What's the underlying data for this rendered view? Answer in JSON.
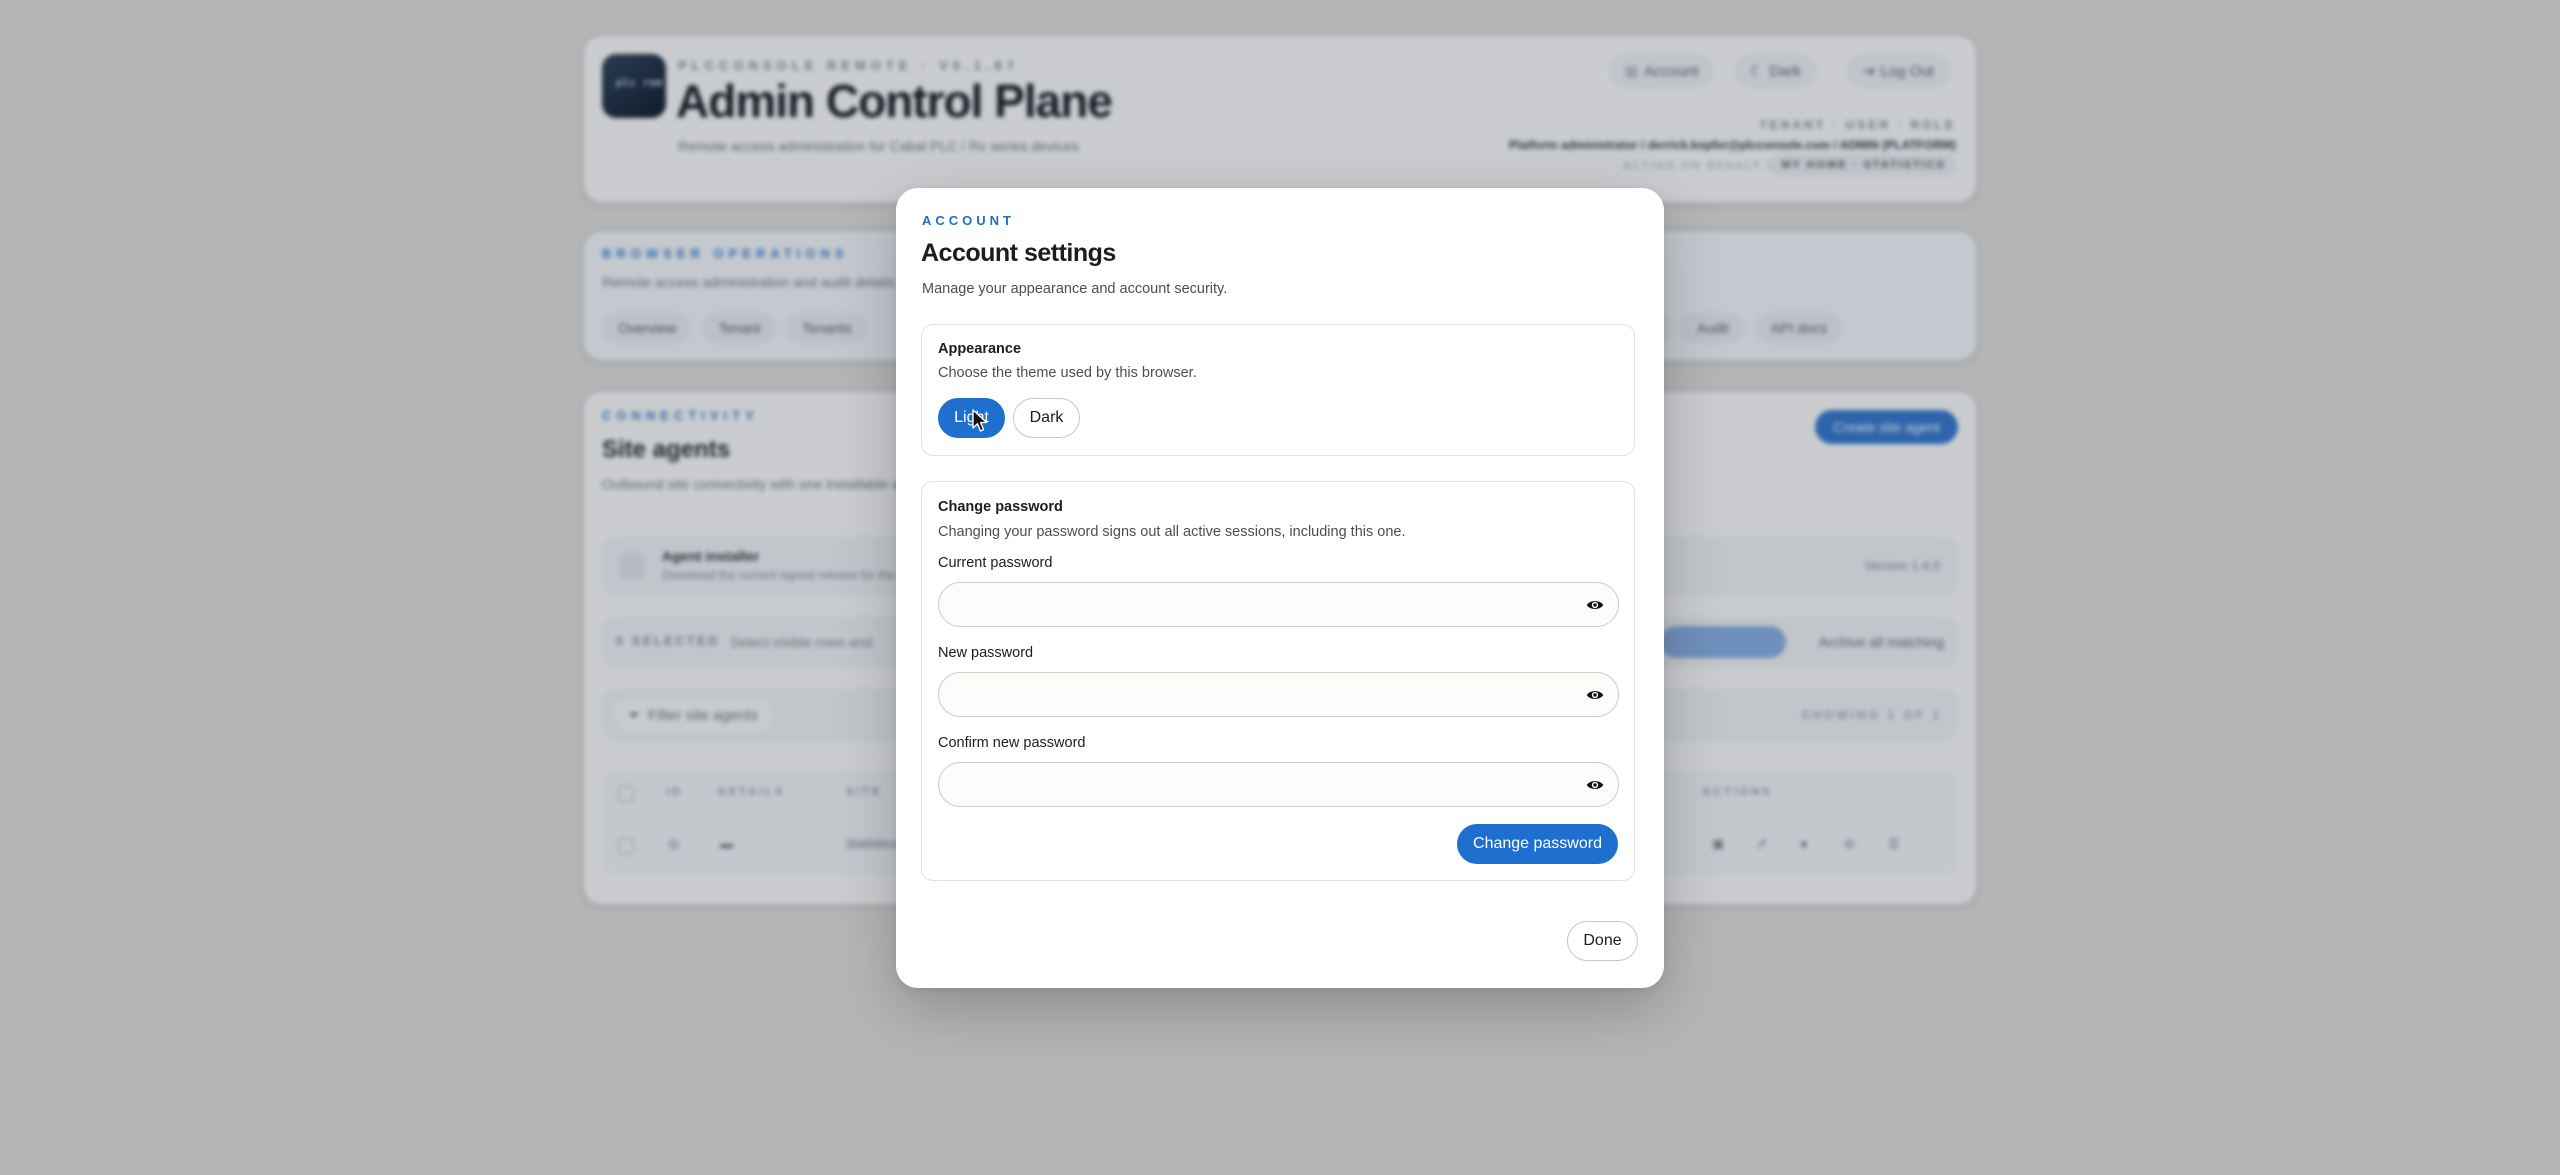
{
  "background": {
    "header": {
      "eyebrow": "PLCCONSOLE REMOTE · V0.1.87",
      "title": "Admin Control Plane",
      "subtitle": "Remote access administration for Cabal PLC / Rx series devices",
      "logo_text": "plc\nrem",
      "buttons": {
        "account": "Account",
        "dark": "Dark",
        "logout": "Log Out"
      },
      "right_caption": "TENANT · USER · ROLE",
      "right_line": "Platform administrator / derrick.kopfer@plcconsole.com / ADMIN (PLATFORM)",
      "right_small": "ACTING ON BEHALF OF",
      "right_chip": "MY HOME · STATISTICS"
    },
    "operations": {
      "eyebrow": "BROWSER OPERATIONS",
      "subtitle": "Remote access administration and audit details",
      "tabs": [
        "Overview",
        "Tenant",
        "Tenants"
      ],
      "tabs_right": [
        "s",
        "Audit",
        "API docs"
      ]
    },
    "connectivity": {
      "eyebrow": "CONNECTIVITY",
      "title": "Site agents",
      "subtitle": "Outbound site connectivity with one installable agent",
      "primary_button": "Create site agent",
      "installer_title": "Agent installer",
      "installer_sub": "Download the current signed release for the",
      "installer_right": "Version 1.4.0",
      "selection_count": "0 SELECTED",
      "selection_mid": "Select visible rows and",
      "selection_right": "Archive all matching",
      "filter_label": "Filter site agents",
      "filter_right": "SHOWING 1 OF 1",
      "columns": [
        "ID",
        "DETAILS",
        "SITE"
      ],
      "columns_right": "ACTIONS",
      "row_site": "Statistics"
    }
  },
  "modal": {
    "eyebrow": "ACCOUNT",
    "title": "Account settings",
    "subtitle": "Manage your appearance and account security.",
    "appearance": {
      "title": "Appearance",
      "description": "Choose the theme used by this browser.",
      "options": {
        "light": "Light",
        "dark": "Dark"
      },
      "selected": "Light"
    },
    "password": {
      "title": "Change password",
      "description": "Changing your password signs out all active sessions, including this one.",
      "current_label": "Current password",
      "current_value": "",
      "new_label": "New password",
      "new_value": "",
      "confirm_label": "Confirm new password",
      "confirm_value": "",
      "submit": "Change password"
    },
    "done": "Done"
  },
  "colors": {
    "accent": "#1f6fd0",
    "eyebrow": "#1f6fc4",
    "section_border": "#e4e1da"
  },
  "icons": {
    "eye": "eye-icon",
    "cursor": "pointer-cursor-icon"
  }
}
